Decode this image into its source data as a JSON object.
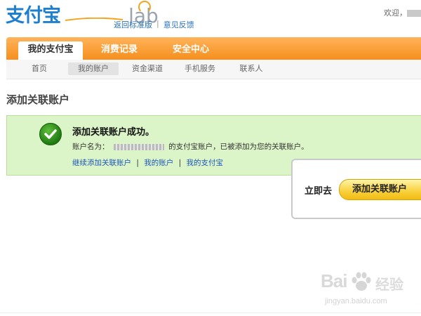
{
  "header": {
    "logo_text": "支付宝",
    "logo_lab": "lab",
    "links": [
      "返回标准版",
      "意见反馈"
    ],
    "welcome": "欢迎，"
  },
  "nav": {
    "tabs": [
      "我的支付宝",
      "消费记录",
      "安全中心"
    ],
    "active_tab": "我的支付宝"
  },
  "subnav": {
    "items": [
      "首页",
      "我的账户",
      "资金渠道",
      "手机服务",
      "联系人"
    ],
    "active_item": "我的账户"
  },
  "page": {
    "title": "添加关联账户"
  },
  "success": {
    "title": "添加关联账户成功。",
    "desc_prefix": "账户名为：",
    "desc_suffix": "的支付宝账户，已被添加为您的关联账户。",
    "links": [
      "继续添加关联账户",
      "我的账户",
      "我的支付宝"
    ]
  },
  "popup": {
    "label": "立即去",
    "button": "添加关联账户"
  },
  "watermark": {
    "logo": "Bai",
    "logo_tail": "经验",
    "url": "jingyan.baidu.com"
  },
  "colors": {
    "nav_orange": "#f58f1d",
    "success_bg": "#dcf5c8",
    "link_blue": "#1d55b8",
    "button_yellow": "#f8d03c"
  }
}
